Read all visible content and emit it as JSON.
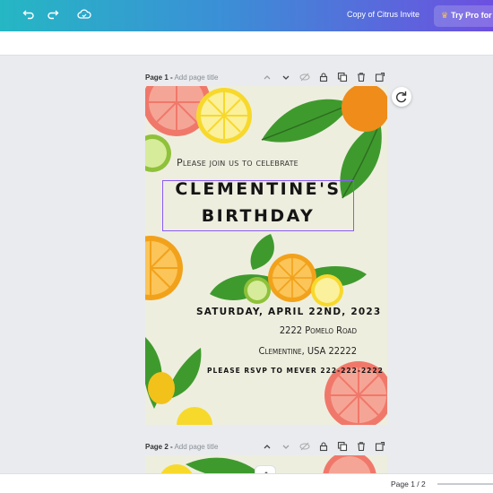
{
  "header": {
    "doc_title": "Copy of Citrus Invite",
    "try_pro_label": "Try Pro for 3",
    "icons": [
      "undo-icon",
      "redo-icon",
      "cloud-saved-icon",
      "crown-icon"
    ]
  },
  "pages": [
    {
      "label": "Page 1 -",
      "title_placeholder": "Add page title"
    },
    {
      "label": "Page 2 -",
      "title_placeholder": "Add page title"
    }
  ],
  "page_head_icons": [
    "chevron-up-icon",
    "chevron-down-icon",
    "hide-icon",
    "lock-icon",
    "duplicate-icon",
    "delete-icon",
    "add-page-icon"
  ],
  "invitation": {
    "intro": "Please join us to celebrate",
    "title_line1": "CLEMENTINE'S",
    "title_line2": "BIRTHDAY",
    "date": "SATURDAY, APRIL 22ND, 2023",
    "address_line1": "2222 Pomelo Road",
    "address_line2": "Clementine, USA 22222",
    "rsvp": "PLEASE RSVP TO MEVER 222-222-2222"
  },
  "footer": {
    "page_count": "Page 1 / 2"
  },
  "colors": {
    "accent": "#8b5cf6",
    "grapefruit": "#f0786a",
    "lemon": "#f7e03a",
    "orange": "#f2a21a",
    "lime": "#9acd32",
    "leaf": "#3f9a2e",
    "page_bg": "#eeeedf"
  }
}
